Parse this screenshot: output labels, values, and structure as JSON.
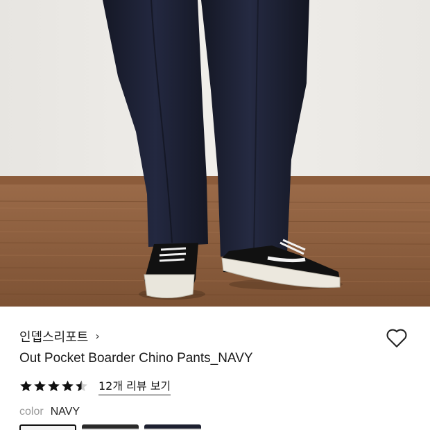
{
  "product": {
    "image_alt": "Navy chino pants with black sneakers",
    "brand": "인뎁스리포트",
    "brand_chevron": "›",
    "name": "Out Pocket Boarder Chino Pants_NAVY",
    "rating": 4.5,
    "review_link": "12개 리뷰 보기",
    "color_label": "color",
    "color_value": "NAVY",
    "swatches": [
      "selected",
      "option-2",
      "option-3"
    ]
  },
  "colors": {
    "pants": "#1d2132",
    "wall": "#eceae6",
    "floor": "#8a5a3a",
    "text": "#1a1a1a",
    "muted": "#999999"
  }
}
